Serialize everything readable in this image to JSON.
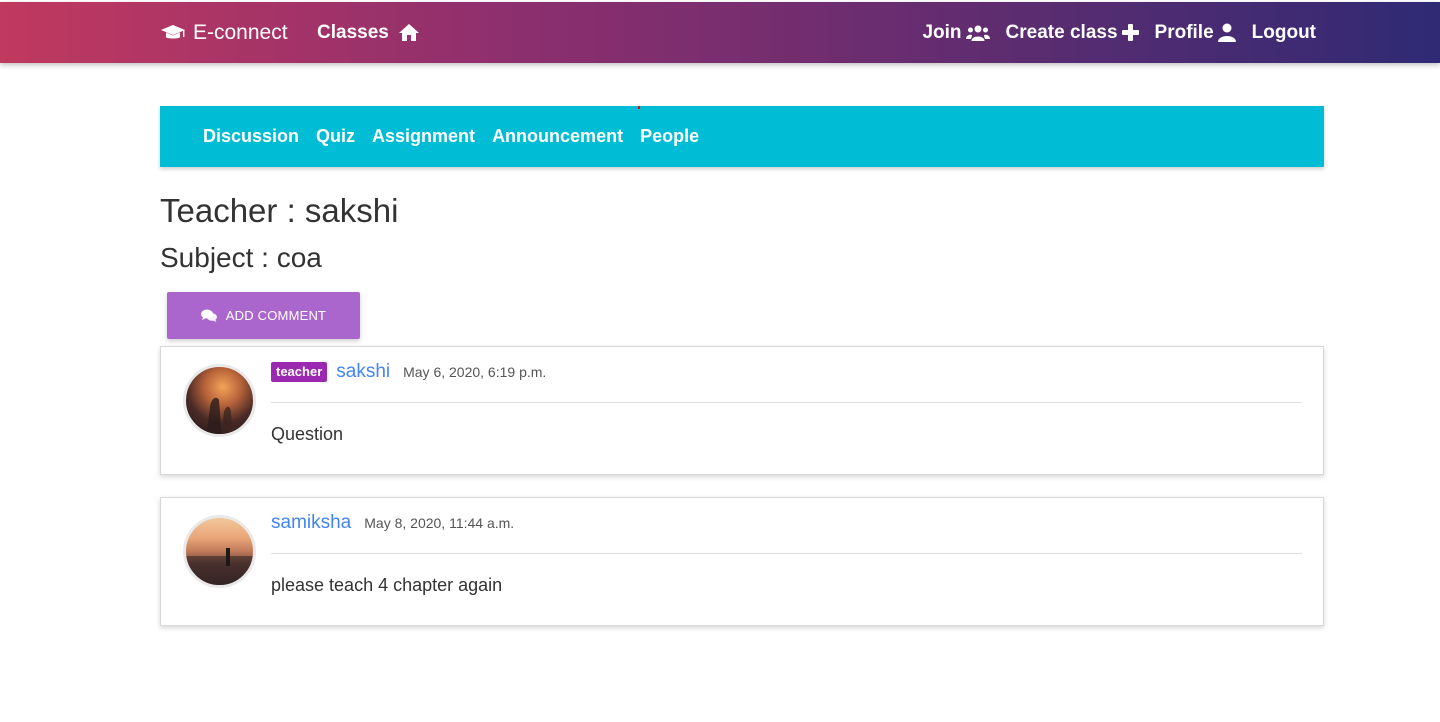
{
  "navbar": {
    "brand": "E-connect",
    "classes_label": "Classes",
    "join_label": "Join",
    "create_class_label": "Create class",
    "profile_label": "Profile",
    "logout_label": "Logout",
    "icons": [
      "graduation-cap-icon",
      "home-icon",
      "users-icon",
      "plus-icon",
      "user-icon"
    ]
  },
  "tabs": [
    {
      "label": "Discussion"
    },
    {
      "label": "Quiz"
    },
    {
      "label": "Assignment"
    },
    {
      "label": "Announcement"
    },
    {
      "label": "People"
    }
  ],
  "header": {
    "teacher": "Teacher : sakshi",
    "subject": "Subject : coa"
  },
  "add_comment": {
    "label": "ADD COMMENT",
    "icon": "comments-icon"
  },
  "comments": [
    {
      "badge": "teacher",
      "author": "sakshi",
      "date": "May 6, 2020, 6:19 p.m.",
      "text": "Question"
    },
    {
      "author": "samiksha",
      "date": "May 8, 2020, 11:44 a.m.",
      "text": "please teach 4 chapter again"
    }
  ],
  "colors": {
    "navbar_gradient_start": "#c0395f",
    "navbar_gradient_end": "#2f2a74",
    "tabbar": "#00bcd4",
    "add_button": "#aa66cc",
    "badge": "#9c27b0",
    "author_link": "#4285f4"
  }
}
